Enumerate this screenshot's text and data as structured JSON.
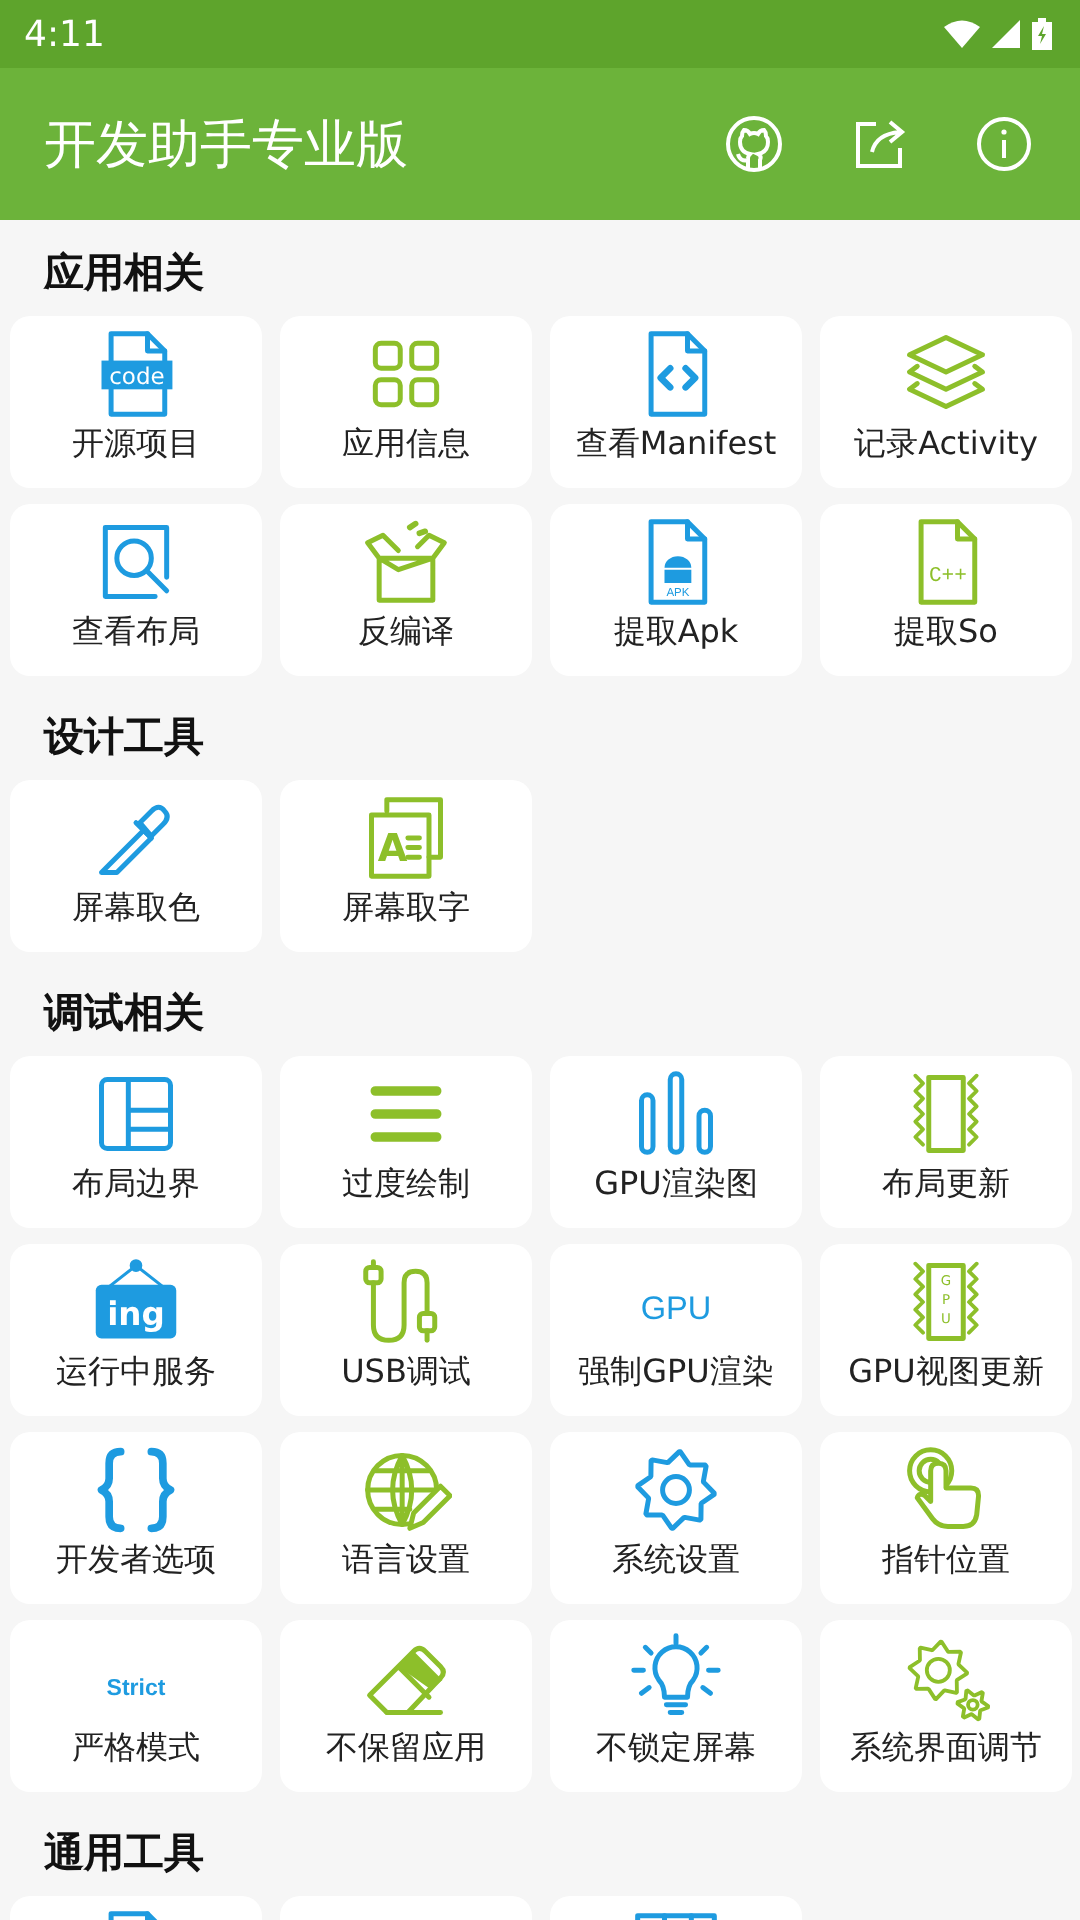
{
  "status_bar": {
    "time": "4:11"
  },
  "app_bar": {
    "title": "开发助手专业版"
  },
  "sections": [
    {
      "title": "应用相关",
      "tools": [
        {
          "label": "开源项目",
          "kind": "code-file",
          "icon_text": "code"
        },
        {
          "label": "应用信息",
          "kind": "grid"
        },
        {
          "label": "查看Manifest",
          "kind": "code-brackets-file"
        },
        {
          "label": "记录Activity",
          "kind": "layers"
        },
        {
          "label": "查看布局",
          "kind": "magnifier-frame"
        },
        {
          "label": "反编译",
          "kind": "open-box"
        },
        {
          "label": "提取Apk",
          "kind": "android-file",
          "icon_text": "APK"
        },
        {
          "label": "提取So",
          "kind": "text-file",
          "icon_text": "C++"
        }
      ]
    },
    {
      "title": "设计工具",
      "tools": [
        {
          "label": "屏幕取色",
          "kind": "eyedropper"
        },
        {
          "label": "屏幕取字",
          "kind": "letter-frame",
          "icon_text": "A"
        }
      ]
    },
    {
      "title": "调试相关",
      "tools": [
        {
          "label": "布局边界",
          "kind": "layout"
        },
        {
          "label": "过度绘制",
          "kind": "lines"
        },
        {
          "label": "GPU渲染图",
          "kind": "bars"
        },
        {
          "label": "布局更新",
          "kind": "wave-frame"
        },
        {
          "label": "运行中服务",
          "kind": "hanging-sign",
          "icon_text": "ing"
        },
        {
          "label": "USB调试",
          "kind": "cable"
        },
        {
          "label": "强制GPU渲染",
          "kind": "word",
          "icon_text": "GPU"
        },
        {
          "label": "GPU视图更新",
          "kind": "wave-frame",
          "icon_text": "GPU"
        },
        {
          "label": "开发者选项",
          "kind": "braces"
        },
        {
          "label": "语言设置",
          "kind": "globe-pencil"
        },
        {
          "label": "系统设置",
          "kind": "gear"
        },
        {
          "label": "指针位置",
          "kind": "hand-pointer"
        },
        {
          "label": "严格模式",
          "kind": "word",
          "icon_text": "Strict"
        },
        {
          "label": "不保留应用",
          "kind": "eraser"
        },
        {
          "label": "不锁定屏幕",
          "kind": "bulb"
        },
        {
          "label": "系统界面调节",
          "kind": "gears"
        }
      ]
    },
    {
      "title": "通用工具",
      "tools": [
        {
          "kind": "document"
        },
        {
          "kind": "empty"
        },
        {
          "kind": "table"
        }
      ]
    }
  ]
}
